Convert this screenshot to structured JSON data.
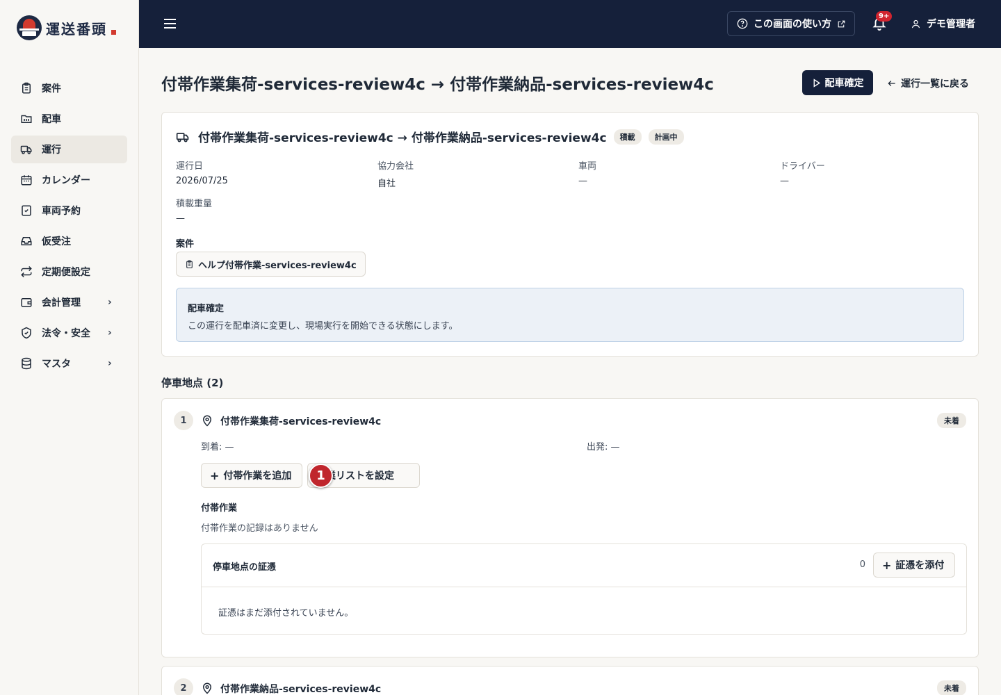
{
  "app": {
    "logo_text": "運送番頭",
    "help_label": "この画面の使い方",
    "notification_badge": "9+",
    "user_name": "デモ管理者"
  },
  "sidebar": {
    "items": [
      {
        "label": "案件",
        "icon": "clipboard-icon",
        "active": false,
        "has_children": false
      },
      {
        "label": "配車",
        "icon": "calendar-folder-icon",
        "active": false,
        "has_children": false
      },
      {
        "label": "運行",
        "icon": "truck-icon",
        "active": true,
        "has_children": false
      },
      {
        "label": "カレンダー",
        "icon": "calendar-icon",
        "active": false,
        "has_children": false
      },
      {
        "label": "車両予約",
        "icon": "calendar-check-icon",
        "active": false,
        "has_children": false
      },
      {
        "label": "仮受注",
        "icon": "inbox-icon",
        "active": false,
        "has_children": false
      },
      {
        "label": "定期便設定",
        "icon": "repeat-icon",
        "active": false,
        "has_children": false
      },
      {
        "label": "会計管理",
        "icon": "wallet-icon",
        "active": false,
        "has_children": true
      },
      {
        "label": "法令・安全",
        "icon": "shield-icon",
        "active": false,
        "has_children": true
      },
      {
        "label": "マスタ",
        "icon": "database-icon",
        "active": false,
        "has_children": true
      }
    ]
  },
  "page": {
    "title": "付帯作業集荷-services-review4c → 付帯作業納品-services-review4c",
    "confirm_button": "配車確定",
    "back_link": "運行一覧に戻る"
  },
  "trip": {
    "title": "付帯作業集荷-services-review4c → 付帯作業納品-services-review4c",
    "tags": [
      "積載",
      "計画中"
    ],
    "fields": [
      {
        "label": "運行日",
        "value": "2026/07/25"
      },
      {
        "label": "協力会社",
        "value": "自社"
      },
      {
        "label": "車両",
        "value": "—"
      },
      {
        "label": "ドライバー",
        "value": "—"
      },
      {
        "label": "積載重量",
        "value": "—"
      }
    ],
    "case_label": "案件",
    "case_chip": "ヘルプ付帯作業-services-review4c",
    "info_title": "配車確定",
    "info_desc": "この運行を配車済に変更し、現場実行を開始できる状態にします。"
  },
  "stops": {
    "heading": "停車地点 (2)",
    "items": [
      {
        "number": "1",
        "name": "付帯作業集荷-services-review4c",
        "status": "未着",
        "arrive": "到着: —",
        "depart": "出発: —",
        "add_work_label": "付帯作業を追加",
        "set_list_label": "作業リストを設定",
        "work_label": "付帯作業",
        "work_empty": "付帯作業の記録はありません",
        "evidence_title": "停車地点の証憑",
        "evidence_count": "0",
        "evidence_add": "証憑を添付",
        "evidence_empty": "証憑はまだ添付されていません。"
      },
      {
        "number": "2",
        "name": "付帯作業納品-services-review4c",
        "status": "未着"
      }
    ]
  },
  "annotation_marker": "1",
  "colors": {
    "topbar": "#15203a",
    "accent": "#15203a",
    "marker": "#c0262d",
    "info_bg": "#ecf1f7"
  }
}
